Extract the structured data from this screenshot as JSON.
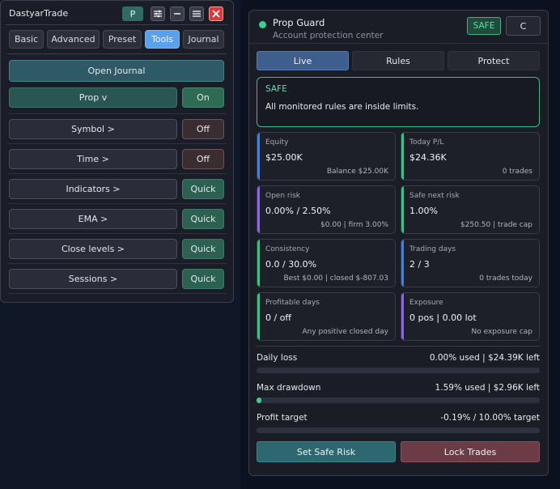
{
  "left_panel": {
    "title": "DastyarTrade",
    "profile_badge": "P",
    "header_icons": [
      "sliders-icon",
      "minimize-icon",
      "menu-icon",
      "close-icon"
    ],
    "tabs": [
      {
        "label": "Basic",
        "active": false
      },
      {
        "label": "Advanced",
        "active": false
      },
      {
        "label": "Preset",
        "active": false
      },
      {
        "label": "Tools",
        "active": true
      },
      {
        "label": "Journal",
        "active": false
      }
    ],
    "open_journal": "Open Journal",
    "rows": [
      {
        "label": "Prop  v",
        "toggle": "On"
      },
      {
        "label": "Symbol  >",
        "toggle": "Off"
      },
      {
        "label": "Time  >",
        "toggle": "Off"
      },
      {
        "label": "Indicators  >",
        "toggle": "Quick"
      },
      {
        "label": "EMA  >",
        "toggle": "Quick"
      },
      {
        "label": "Close levels  >",
        "toggle": "Quick"
      },
      {
        "label": "Sessions  >",
        "toggle": "Quick"
      }
    ]
  },
  "right_panel": {
    "title": "Prop Guard",
    "subtitle": "Account protection center",
    "status_badge": "SAFE",
    "c_button": "C",
    "tabs": [
      {
        "label": "Live",
        "active": true
      },
      {
        "label": "Rules",
        "active": false
      },
      {
        "label": "Protect",
        "active": false
      }
    ],
    "status": {
      "title": "SAFE",
      "message": "All monitored rules are inside limits."
    },
    "cards": [
      {
        "label": "Equity",
        "value": "$25.00K",
        "sub": "Balance $25.00K",
        "accent": "#4a7fd0"
      },
      {
        "label": "Today P/L",
        "value": "$24.36K",
        "sub": "0 trades",
        "accent": "#3ec08a"
      },
      {
        "label": "Open risk",
        "value": "0.00% / 2.50%",
        "sub": "$0.00 | firm 3.00%",
        "accent": "#8a6ad8"
      },
      {
        "label": "Safe next risk",
        "value": "1.00%",
        "sub": "$250.50 | trade cap",
        "accent": "#3ec08a"
      },
      {
        "label": "Consistency",
        "value": "0.0 / 30.0%",
        "sub": "Best $0.00 | closed $-807.03",
        "accent": "#3ec08a"
      },
      {
        "label": "Trading days",
        "value": "2 / 3",
        "sub": "0 trades today",
        "accent": "#4a7fd0"
      },
      {
        "label": "Profitable days",
        "value": "0 / off",
        "sub": "Any positive closed day",
        "accent": "#3ec08a"
      },
      {
        "label": "Exposure",
        "value": "0 pos | 0.00 lot",
        "sub": "No exposure cap",
        "accent": "#8a6ad8"
      }
    ],
    "meters": [
      {
        "label": "Daily loss",
        "value": "0.00% used | $24.39K left",
        "fill": 0.0
      },
      {
        "label": "Max drawdown",
        "value": "1.59% used | $2.96K left",
        "fill": 0.0159
      },
      {
        "label": "Profit target",
        "value": "-0.19% / 10.00% target",
        "fill": 0.0
      }
    ],
    "actions": {
      "safe_risk": "Set Safe Risk",
      "lock_trades": "Lock Trades"
    }
  }
}
